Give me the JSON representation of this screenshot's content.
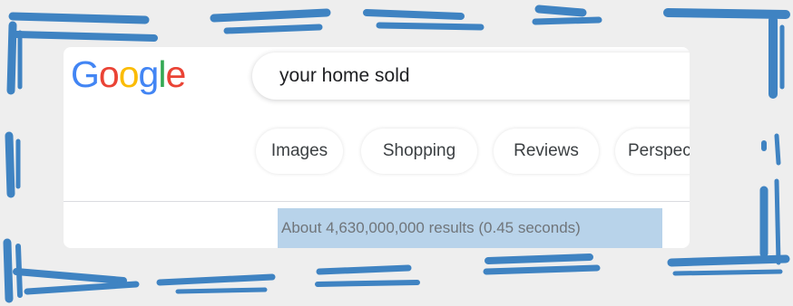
{
  "logo": {
    "text": "Google",
    "letters": [
      {
        "ch": "G",
        "color": "#4285F4"
      },
      {
        "ch": "o",
        "color": "#EA4335"
      },
      {
        "ch": "o",
        "color": "#FBBC05"
      },
      {
        "ch": "g",
        "color": "#4285F4"
      },
      {
        "ch": "l",
        "color": "#34A853"
      },
      {
        "ch": "e",
        "color": "#EA4335"
      }
    ]
  },
  "search": {
    "query": "your home sold"
  },
  "tabs": [
    {
      "label": "Images"
    },
    {
      "label": "Shopping"
    },
    {
      "label": "Reviews"
    },
    {
      "label": "Perspec"
    }
  ],
  "results": {
    "stats": "About 4,630,000,000 results (0.45 seconds)"
  },
  "colors": {
    "frame_marker": "#3f83c2",
    "highlight": "#b8d3ea",
    "background": "#eeeeee"
  }
}
